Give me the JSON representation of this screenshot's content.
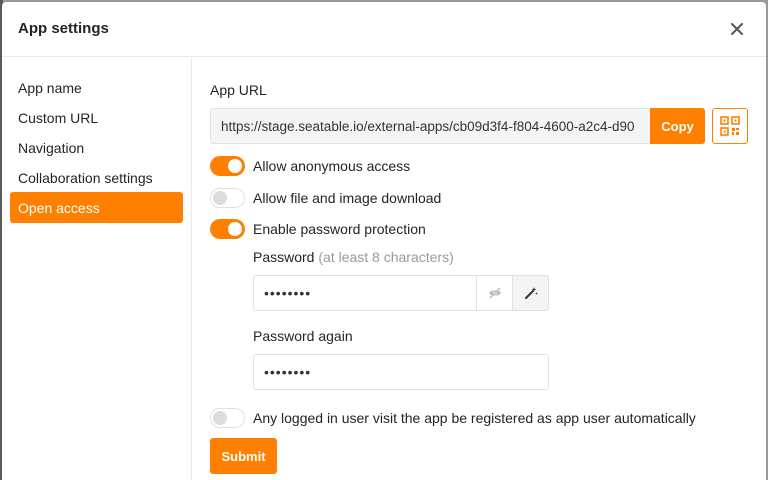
{
  "modal": {
    "title": "App settings"
  },
  "sidebar": {
    "items": [
      {
        "label": "App name"
      },
      {
        "label": "Custom URL"
      },
      {
        "label": "Navigation"
      },
      {
        "label": "Collaboration settings"
      },
      {
        "label": "Open access",
        "active": true
      }
    ]
  },
  "app_url": {
    "label": "App URL",
    "value": "https://stage.seatable.io/external-apps/cb09d3f4-f804-4600-a2c4-d90",
    "copy_label": "Copy",
    "qr_icon": "qr-code-icon"
  },
  "options": {
    "anonymous": {
      "label": "Allow anonymous access",
      "on": true
    },
    "download": {
      "label": "Allow file and image download",
      "on": false
    },
    "password_protection": {
      "label": "Enable password protection",
      "on": true
    },
    "auto_register": {
      "label": "Any logged in user visit the app be registered as app user automatically",
      "on": false
    }
  },
  "password": {
    "label": "Password",
    "hint": "(at least 8 characters)",
    "value": "••••••••",
    "again_label": "Password again",
    "again_value": "••••••••"
  },
  "submit_label": "Submit",
  "colors": {
    "accent": "#ff8000"
  }
}
